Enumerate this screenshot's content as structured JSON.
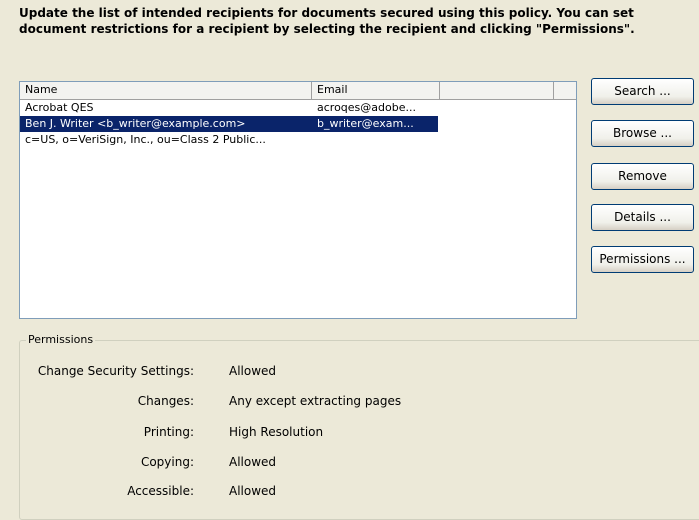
{
  "instructions": {
    "line1": "Update the list of intended recipients for documents secured using this policy. You can set",
    "line2": "document restrictions for a recipient by selecting the recipient and clicking \"Permissions\"."
  },
  "recipients": {
    "columns": [
      "Name",
      "Email"
    ],
    "rows": [
      {
        "name": "Acrobat QES",
        "email": "acroqes@adobe...",
        "selected": false
      },
      {
        "name": "Ben J. Writer <b_writer@example.com>",
        "email": "b_writer@exam...",
        "selected": true
      },
      {
        "name": "c=US, o=VeriSign, Inc., ou=Class 2 Public...",
        "email": "",
        "selected": false
      }
    ]
  },
  "buttons": {
    "search": "Search ...",
    "browse": "Browse ...",
    "remove": "Remove",
    "details": "Details ...",
    "permissions": "Permissions ..."
  },
  "permissions": {
    "legend": "Permissions",
    "items": [
      {
        "label": "Change Security Settings:",
        "value": "Allowed"
      },
      {
        "label": "Changes:",
        "value": "Any except extracting pages"
      },
      {
        "label": "Printing:",
        "value": "High Resolution"
      },
      {
        "label": "Copying:",
        "value": "Allowed"
      },
      {
        "label": "Accessible:",
        "value": "Allowed"
      }
    ]
  },
  "colors": {
    "selection": "#0a246a",
    "dialog_background": "#ece9d8"
  }
}
